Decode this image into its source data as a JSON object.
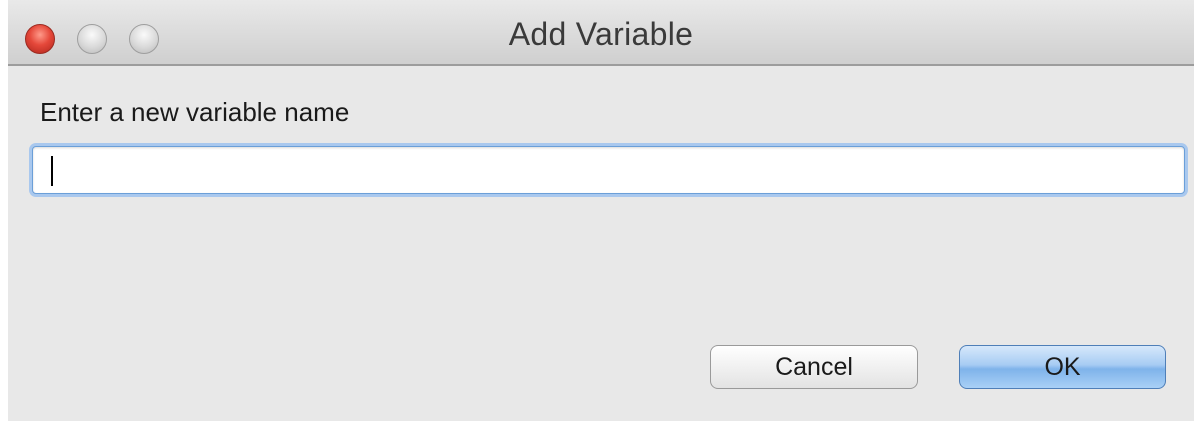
{
  "window": {
    "title": "Add Variable"
  },
  "form": {
    "prompt_label": "Enter a new variable name",
    "name_value": "",
    "name_placeholder": ""
  },
  "buttons": {
    "cancel_label": "Cancel",
    "ok_label": "OK"
  },
  "titlebar_controls": {
    "close_icon": "close-icon",
    "minimize_icon": "minimize-icon",
    "zoom_icon": "zoom-icon",
    "close_color": "#e5483a",
    "inactive_color": "#d9d9d9"
  },
  "colors": {
    "focus_ring": "#a9c8ee",
    "default_button": "#7fb3ea",
    "window_bg": "#e8e8e8"
  }
}
